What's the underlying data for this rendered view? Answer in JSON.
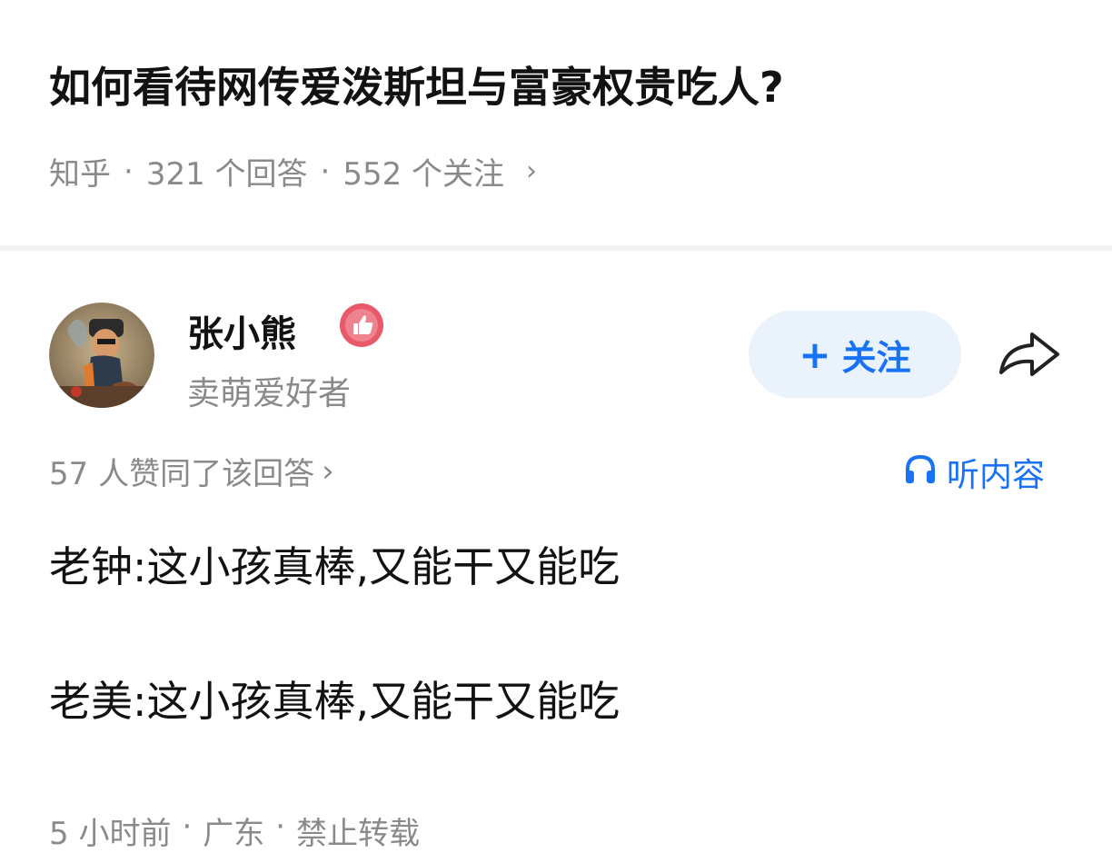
{
  "question": {
    "title": "如何看待网传爱泼斯坦与富豪权贵吃人?",
    "source": "知乎",
    "answers_count": "321 个回答",
    "followers_count": "552 个关注",
    "chevron": "›"
  },
  "author": {
    "name": "张小熊",
    "bio": "卖萌爱好者",
    "badge_icon": "thumbs-up-badge-icon",
    "avatar_icon": "avatar-image",
    "follow_plus": "+",
    "follow_label": "关注",
    "share_icon": "share-icon"
  },
  "meta": {
    "votes": "57 人赞同了该回答",
    "chevron": "›",
    "listen_label": "听内容",
    "listen_icon": "headphones-icon"
  },
  "answer": {
    "line1": "老钟:这小孩真棒,又能干又能吃",
    "line2": "老美:这小孩真棒,又能干又能吃"
  },
  "footer": {
    "time": "5 小时前",
    "location": "广东",
    "rights": "禁止转载"
  },
  "colors": {
    "accent": "#1772f6",
    "follow_bg": "#eaf2fb",
    "muted": "#8a8a8a",
    "text": "#121212",
    "badge": "#e85a6a"
  }
}
